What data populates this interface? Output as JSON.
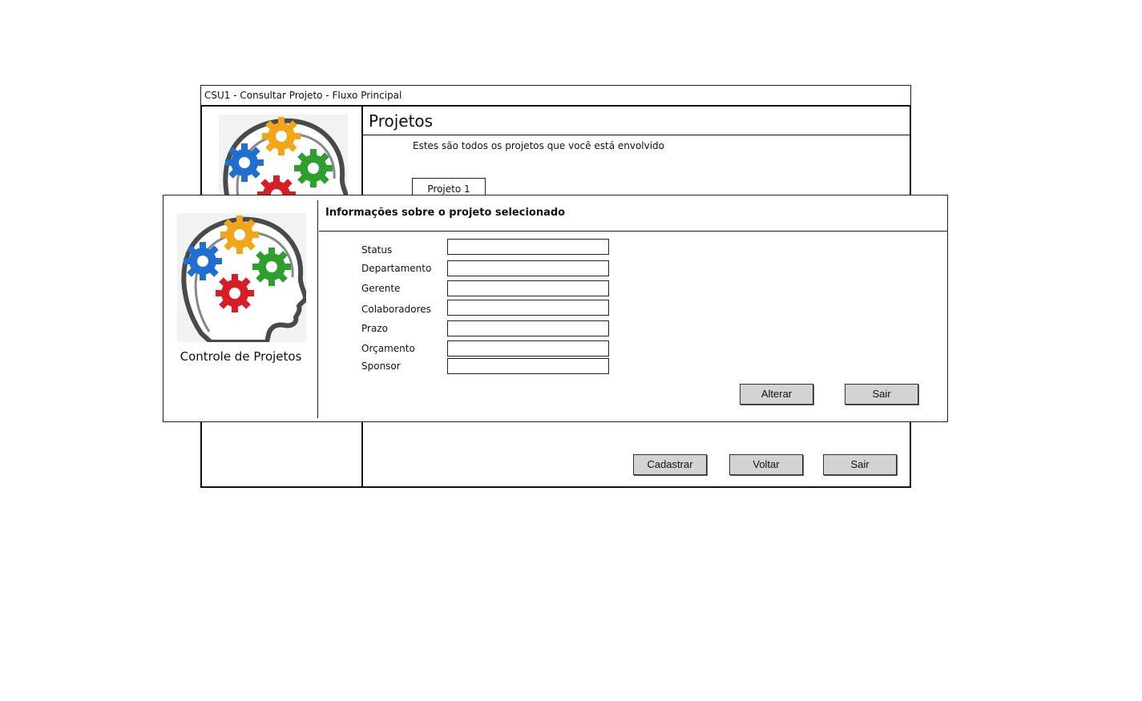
{
  "window": {
    "title": "CSU1 - Consultar Projeto - Fluxo Principal"
  },
  "projects_page": {
    "heading": "Projetos",
    "description": "Estes são todos os projetos que você está envolvido",
    "project_tab": "Projeto 1",
    "buttons": {
      "register": "Cadastrar",
      "back": "Voltar",
      "exit": "Sair"
    }
  },
  "dialog": {
    "title": "Informações sobre o projeto selecionado",
    "app_name": "Controle de Projetos",
    "fields": [
      {
        "label": "Status",
        "value": ""
      },
      {
        "label": "Departamento",
        "value": ""
      },
      {
        "label": "Gerente",
        "value": ""
      },
      {
        "label": "Colaboradores",
        "value": ""
      },
      {
        "label": "Prazo",
        "value": ""
      },
      {
        "label": "Orçamento",
        "value": ""
      },
      {
        "label": "Sponsor",
        "value": ""
      }
    ],
    "buttons": {
      "edit": "Alterar",
      "exit": "Sair"
    }
  },
  "colors": {
    "button_bg": "#d3d3d3",
    "gear_blue": "#1f6fd1",
    "gear_orange": "#f2a516",
    "gear_green": "#2e9e2e",
    "gear_red": "#d81e25"
  },
  "icons": [
    "brain-gears-logo"
  ]
}
